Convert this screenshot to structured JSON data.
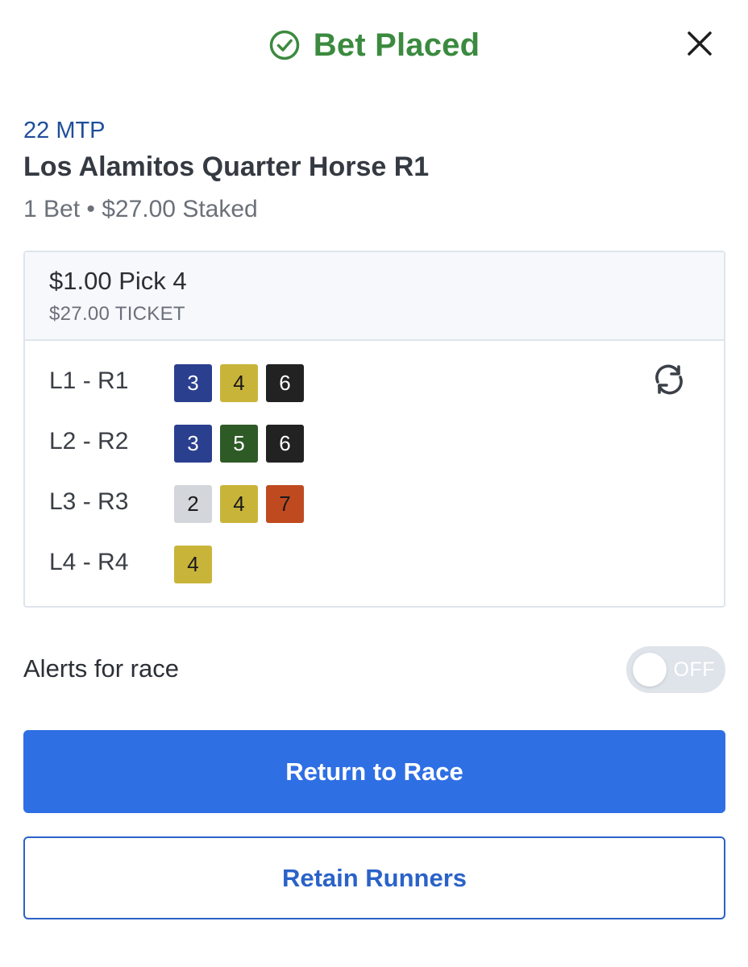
{
  "header": {
    "title": "Bet Placed",
    "title_color": "#3b8a3f",
    "status_icon": "check-circle-icon",
    "close_icon": "close-icon"
  },
  "race": {
    "mtp": "22 MTP",
    "name": "Los Alamitos Quarter Horse R1",
    "summary": "1 Bet • $27.00 Staked"
  },
  "bet": {
    "type": "$1.00 Pick 4",
    "ticket": "$27.00 TICKET",
    "refresh_icon": "repeat-bet-icon",
    "legs": [
      {
        "label": "L1 - R1",
        "runners": [
          {
            "number": "3",
            "bg": "#2b3f8f",
            "fg": "#ffffff"
          },
          {
            "number": "4",
            "bg": "#c9b43a",
            "fg": "#1a1a1a"
          },
          {
            "number": "6",
            "bg": "#222222",
            "fg": "#ffffff"
          }
        ]
      },
      {
        "label": "L2 - R2",
        "runners": [
          {
            "number": "3",
            "bg": "#2b3f8f",
            "fg": "#ffffff"
          },
          {
            "number": "5",
            "bg": "#2e5a26",
            "fg": "#ffffff"
          },
          {
            "number": "6",
            "bg": "#222222",
            "fg": "#ffffff"
          }
        ]
      },
      {
        "label": "L3 - R3",
        "runners": [
          {
            "number": "2",
            "bg": "#d3d6db",
            "fg": "#1a1a1a"
          },
          {
            "number": "4",
            "bg": "#c9b43a",
            "fg": "#1a1a1a"
          },
          {
            "number": "7",
            "bg": "#c04a20",
            "fg": "#1a1a1a"
          }
        ]
      },
      {
        "label": "L4 - R4",
        "runners": [
          {
            "number": "4",
            "bg": "#c9b43a",
            "fg": "#1a1a1a"
          }
        ]
      }
    ]
  },
  "alerts": {
    "label": "Alerts for race",
    "toggle_state": "OFF"
  },
  "buttons": {
    "return": "Return to Race",
    "retain": "Retain Runners"
  },
  "colors": {
    "primary": "#2f6fe4",
    "secondary_border": "#2a62c8",
    "mtp": "#1f4e9a"
  }
}
